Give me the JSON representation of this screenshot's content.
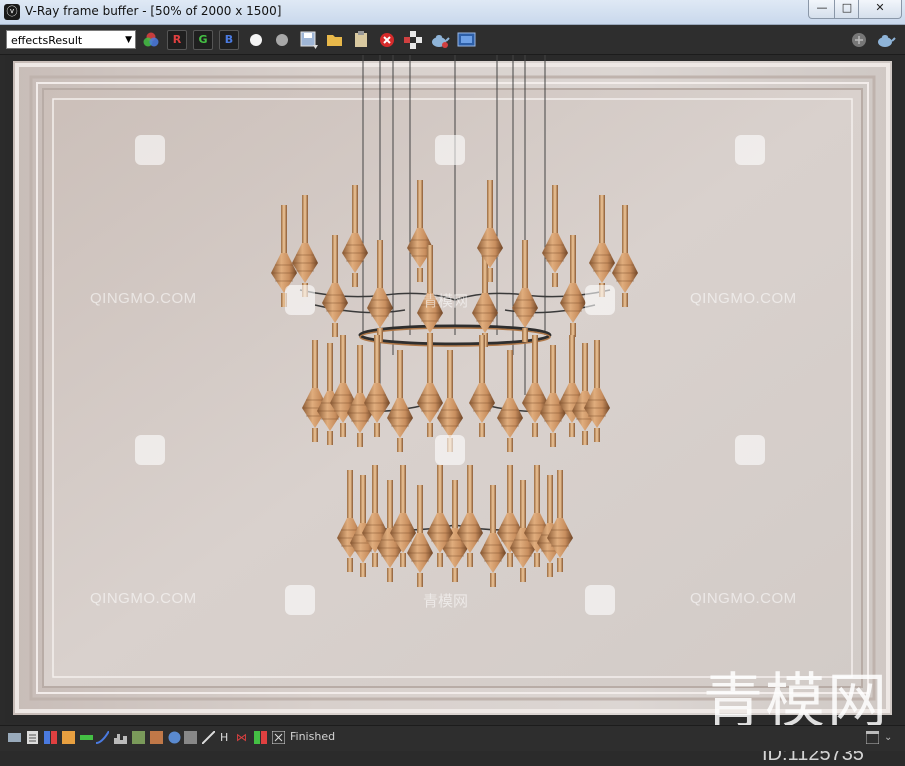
{
  "window": {
    "title": "V-Ray frame buffer - [50% of 2000 x 1500]",
    "min_label": "—",
    "max_label": "□",
    "close_label": "✕"
  },
  "toolbar": {
    "channel_value": "effectsResult",
    "r_label": "R",
    "g_label": "G",
    "b_label": "B"
  },
  "status": {
    "text": "Finished"
  },
  "watermark": {
    "site": "QINGMO.COM",
    "cn": "青模网",
    "brand": "青模网",
    "id": "ID:1125735"
  },
  "colors": {
    "wall": "#d6ccc6",
    "brass": "#c8905c",
    "red": "#e04040",
    "green": "#44c044",
    "blue": "#4a7ae0"
  }
}
